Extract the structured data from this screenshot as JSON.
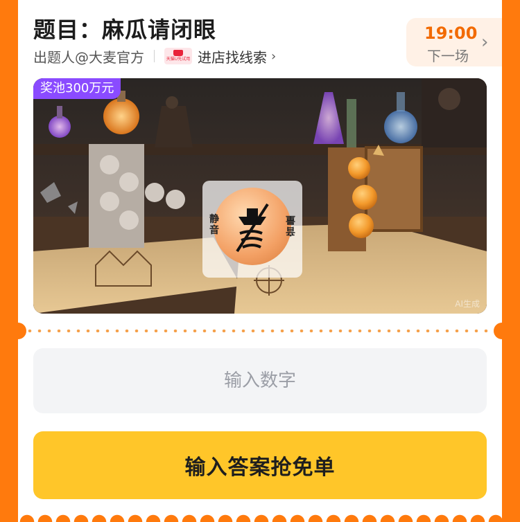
{
  "header": {
    "title": "题目：麻瓜请闭眼",
    "author": "出题人@大麦官方",
    "store_logo_text": "天猫U先试用",
    "store_link": "进店找线索",
    "store_link_chevron": "›"
  },
  "next_session": {
    "time": "19:00",
    "label": "下一场",
    "chevron": "›"
  },
  "banner": {
    "prize_tag": "奖池300万元",
    "mute_left_label": "静音",
    "mute_right_label": "音量",
    "ai_mark": "AI生成",
    "icons": [
      "speaker-mute-icon",
      "potion-bottles",
      "cards-stack",
      "oranges-box",
      "map"
    ]
  },
  "answer": {
    "placeholder": "输入数字",
    "submit_label": "输入答案抢免单"
  },
  "colors": {
    "background": "#ff7a0d",
    "accent": "#f26a00",
    "button": "#ffc629",
    "prize_tag": "#8a4bff"
  }
}
